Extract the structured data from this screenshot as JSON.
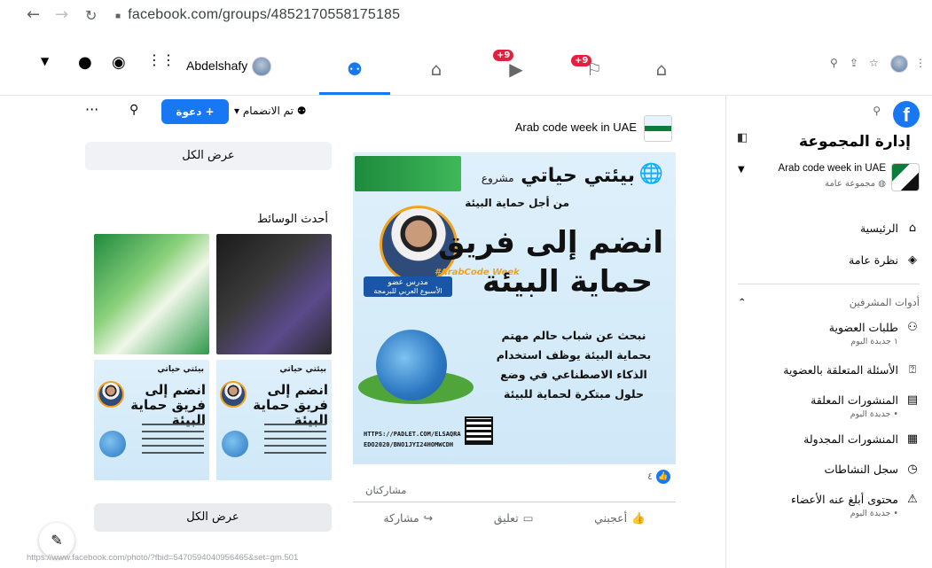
{
  "browser": {
    "url": "facebook.com/groups/4852170558175185",
    "status_url": "https://www.facebook.com/photo/?fbid=5470594040956465&set=gm.501"
  },
  "topnav": {
    "username": "Abdelshafy",
    "badges": [
      "+9",
      "+9"
    ]
  },
  "sidebar": {
    "title": "إدارة المجموعة",
    "group_name": "Arab code week in UAE",
    "group_type": "مجموعة عامة",
    "nav": [
      {
        "label": "الرئيسية",
        "icon": "home-icon"
      },
      {
        "label": "نظرة عامة",
        "icon": "overview-icon"
      }
    ],
    "tools_header": "أدوات المشرفين",
    "tools": [
      {
        "label": "طلبات العضوية",
        "sub": "١ جديدة اليوم",
        "icon": "add-member-icon"
      },
      {
        "label": "الأسئلة المتعلقة بالعضوية",
        "sub": "",
        "icon": "question-icon"
      },
      {
        "label": "المنشورات المعلقة",
        "sub": "• جديدة اليوم",
        "icon": "pending-icon"
      },
      {
        "label": "المنشورات المجدولة",
        "sub": "",
        "icon": "calendar-icon"
      },
      {
        "label": "سجل النشاطات",
        "sub": "",
        "icon": "clock-icon"
      },
      {
        "label": "محتوى أبلغ عنه الأعضاء",
        "sub": "• جديدة اليوم",
        "icon": "report-icon"
      }
    ]
  },
  "left": {
    "joined": "تم الانضمام",
    "invite": "+ دعوة",
    "view_all_top": "عرض الكل",
    "media_title": "أحدث الوسائط",
    "view_all_bottom": "عرض الكل",
    "mini_title": "بيئتي حياتي",
    "mini_big": "انضم إلى فريق حماية البيئة"
  },
  "post": {
    "group_name": "Arab code week in UAE",
    "poster_title": "بيئتي حياتي",
    "poster_prefix": "مشروع",
    "poster_subtitle": "من أجل حماية البيئة",
    "poster_big1": "انضم إلى فريق",
    "poster_big2": "حماية البيئة",
    "poster_tag": "مدرس عضو",
    "poster_tag_sub": "الأسبوع العربي للبرمجة",
    "poster_tag2": "#ArabCode Week",
    "poster_body": "نبحث عن شباب حالم مهتم بحماية البيئة يوظف استخدام الذكاء الاصطناعي في وضع حلول مبتكرة لحماية للبيئة",
    "poster_link1": "HTTPS://PADLET.COM/ELSAQRA",
    "poster_link2": "EDO2020/BNO1JYI24HOMWCDH",
    "like_count": "٤",
    "shares": "مشاركتان",
    "actions": {
      "like": "أعجبني",
      "comment": "تعليق",
      "share": "مشاركة"
    }
  }
}
